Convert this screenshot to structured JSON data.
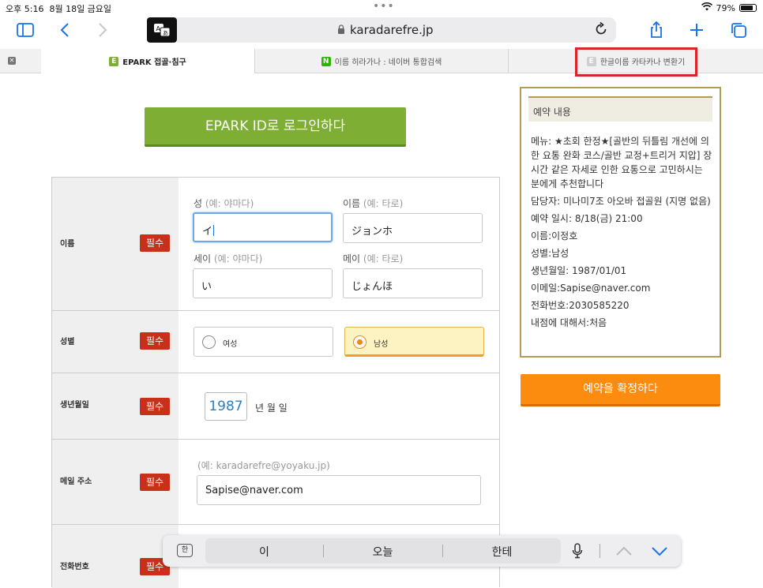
{
  "status": {
    "time": "오후 5:16",
    "date": "8월 18일 금요일",
    "battery": "79%"
  },
  "toolbar": {
    "url": "karadarefre.jp",
    "ext_label": "🏯"
  },
  "tabs": [
    {
      "label": "EPARK 접골·침구",
      "fav": "E",
      "fav_color": "#7fae34"
    },
    {
      "label": "이름 히라가나 : 네이버 통합검색",
      "fav": "N",
      "fav_color": "#2db400"
    },
    {
      "label": "한글이름 카타카나 변환기",
      "fav": "E",
      "fav_color": "#cfcfcf"
    }
  ],
  "login_button": "EPARK ID로 로그인하다",
  "form": {
    "name": {
      "label": "이름",
      "required": "필수",
      "sei_label": "성",
      "sei_hint": "(예: 야마다)",
      "sei_value": "イ",
      "mei_label": "이름",
      "mei_hint": "(예: 타로)",
      "mei_value": "ジョンホ",
      "sei_kana_label": "세이",
      "sei_kana_hint": "(예: 야마다)",
      "sei_kana_value": "い",
      "mei_kana_label": "메이",
      "mei_kana_hint": "(예: 타로)",
      "mei_kana_value": "じょんほ"
    },
    "gender": {
      "label": "성별",
      "required": "필수",
      "female": "여성",
      "male": "남성"
    },
    "birth": {
      "label": "생년월일",
      "required": "필수",
      "year": "1987",
      "suffix": "년 월 일"
    },
    "email": {
      "label": "메일 주소",
      "required": "필수",
      "hint": "(예: karadarefre@yoyaku.jp)",
      "value": "Sapise@naver.com"
    },
    "phone": {
      "label": "전화번호",
      "required": "필수"
    }
  },
  "summary": {
    "title": "예약 내용",
    "menu": "메뉴: ★초회 한정★[골반의 뒤틀림 개선에 의한 요통 완화 코스/골반 교정+트리거 지압] 장시간 같은 자세로 인한 요통으로 고민하시는 분에게 추천합니다",
    "staff": "담당자: 미나미7조 아오바 접골원 (지명 없음)",
    "datetime": "예약 일시: 8/18(금) 21:00",
    "name": "이름:이정호",
    "gender": "성별:남성",
    "birth": "생년월일: 1987/01/01",
    "email": "이메일:Sapise@naver.com",
    "phone": "전화번호:2030585220",
    "visit": "내점에 대해서:처음"
  },
  "confirm_button": "예약을 확정하다",
  "keyboard": {
    "lang": "한",
    "suggestions": [
      "이",
      "오늘",
      "한테"
    ]
  }
}
